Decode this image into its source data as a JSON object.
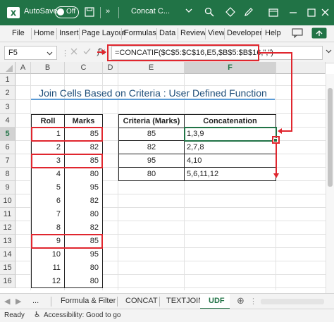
{
  "window": {
    "autosave_label": "AutoSave",
    "autosave_state": "Off",
    "doc_title": "Concat C...",
    "more_glyph": "»"
  },
  "ribbon_tabs": [
    "File",
    "Home",
    "Insert",
    "Page Layout",
    "Formulas",
    "Data",
    "Review",
    "View",
    "Developer",
    "Help"
  ],
  "formula_bar": {
    "name_box": "F5",
    "fx": "fx",
    "formula": "=CONCATIF($C$5:$C$16,E5,$B$5:$B$16,\",\")"
  },
  "columns": [
    "A",
    "B",
    "C",
    "D",
    "E",
    "F"
  ],
  "rows": [
    "1",
    "2",
    "3",
    "4",
    "5",
    "6",
    "7",
    "8",
    "9",
    "10",
    "11",
    "12",
    "13",
    "14",
    "15",
    "16"
  ],
  "sheet_title": "Join Cells Based on Criteria : User Defined Function",
  "left_table": {
    "headers": [
      "Roll",
      "Marks"
    ],
    "rows": [
      [
        "1",
        "85"
      ],
      [
        "2",
        "82"
      ],
      [
        "3",
        "85"
      ],
      [
        "4",
        "80"
      ],
      [
        "5",
        "95"
      ],
      [
        "6",
        "82"
      ],
      [
        "7",
        "80"
      ],
      [
        "8",
        "82"
      ],
      [
        "9",
        "85"
      ],
      [
        "10",
        "95"
      ],
      [
        "11",
        "80"
      ],
      [
        "12",
        "80"
      ]
    ]
  },
  "right_table": {
    "headers": [
      "Criteria (Marks)",
      "Concatenation"
    ],
    "rows": [
      [
        "85",
        "1,3,9"
      ],
      [
        "82",
        "2,7,8"
      ],
      [
        "95",
        "4,10"
      ],
      [
        "80",
        "5,6,11,12"
      ]
    ]
  },
  "sheet_tabs": [
    "...",
    "Formula & Filter",
    "CONCAT",
    "TEXTJOIN",
    "UDF"
  ],
  "active_sheet": "UDF",
  "status": {
    "ready": "Ready",
    "accessibility": "Accessibility: Good to go"
  },
  "colors": {
    "excel_green": "#217346",
    "highlight_red": "#e0262e",
    "title_blue": "#1f4e79"
  }
}
